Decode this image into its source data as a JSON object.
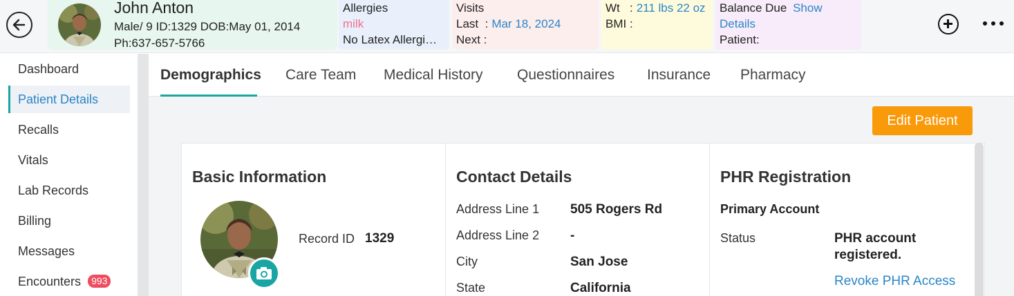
{
  "header": {
    "patient": {
      "name": "John Anton",
      "line1": "Male/ 9  ID:1329  DOB:May 01, 2014",
      "phone": "Ph:637-657-5766"
    },
    "allergies": {
      "label": "Allergies",
      "item1": "milk",
      "item2": "No Latex Allergi…"
    },
    "visits": {
      "label": "Visits",
      "last_label": "Last",
      "last_value": "Mar 18, 2024",
      "next_label": "Next"
    },
    "vitals": {
      "wt_label": "Wt",
      "wt_value": "211 lbs 22 oz",
      "bmi_label": "BMI"
    },
    "balance": {
      "label": "Balance Due",
      "link1": "Show",
      "link2": "Details",
      "patient_label": "Patient"
    }
  },
  "sidebar": {
    "items": [
      {
        "label": "Dashboard"
      },
      {
        "label": "Patient Details"
      },
      {
        "label": "Recalls"
      },
      {
        "label": "Vitals"
      },
      {
        "label": "Lab Records"
      },
      {
        "label": "Billing"
      },
      {
        "label": "Messages"
      },
      {
        "label": "Encounters",
        "badge": "993"
      }
    ]
  },
  "tabs": [
    "Demographics",
    "Care Team",
    "Medical History",
    "Questionnaires",
    "Insurance",
    "Pharmacy"
  ],
  "edit_button": "Edit Patient",
  "basic": {
    "title": "Basic Information",
    "record_label": "Record ID",
    "record_value": "1329"
  },
  "contact": {
    "title": "Contact Details",
    "rows": [
      {
        "label": "Address Line 1",
        "value": "505 Rogers Rd"
      },
      {
        "label": "Address Line 2",
        "value": "-"
      },
      {
        "label": "City",
        "value": "San Jose"
      },
      {
        "label": "State",
        "value": "California"
      }
    ]
  },
  "phr": {
    "title": "PHR Registration",
    "primary": "Primary Account",
    "status_label": "Status",
    "status_line1": "PHR account",
    "status_line2": "registered.",
    "revoke": "Revoke PHR Access"
  },
  "colors": {
    "accent_teal": "#1aa5a5",
    "link_blue": "#2a85c8",
    "edit_orange": "#f99a0a",
    "badge_red": "#ef4d5f"
  },
  "icons": [
    "back-arrow-icon",
    "plus-circle-icon",
    "more-dots-icon",
    "camera-icon"
  ]
}
